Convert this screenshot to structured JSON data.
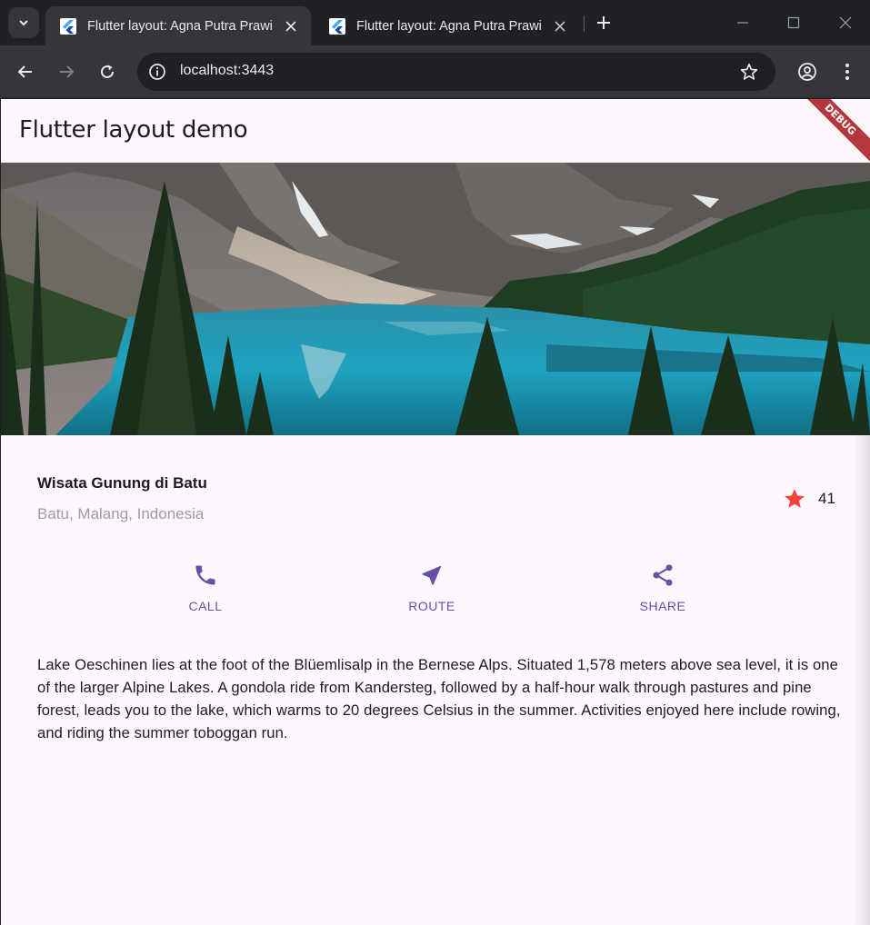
{
  "browser": {
    "tabs": [
      {
        "title": "Flutter layout: Agna Putra Prawi",
        "active": true
      },
      {
        "title": "Flutter layout: Agna Putra Prawi",
        "active": false
      }
    ],
    "url": "localhost:3443"
  },
  "app": {
    "title": "Flutter layout demo",
    "debug_banner": "DEBUG",
    "place": {
      "name": "Wisata Gunung di Batu",
      "location": "Batu, Malang, Indonesia",
      "star_count": "41"
    },
    "actions": [
      {
        "label": "CALL",
        "icon": "phone-icon"
      },
      {
        "label": "ROUTE",
        "icon": "near-me-icon"
      },
      {
        "label": "SHARE",
        "icon": "share-icon"
      }
    ],
    "description": "Lake Oeschinen lies at the foot of the Blüemlisalp in the Bernese Alps. Situated 1,578 meters above sea level, it is one of the larger Alpine Lakes. A gondola ride from Kandersteg, followed by a half-hour walk through pastures and pine forest, leads you to the lake, which warms to 20 degrees Celsius in the summer. Activities enjoyed here include rowing, and riding the summer toboggan run."
  },
  "colors": {
    "primary": "#6750a4",
    "star": "#f44336",
    "surface": "#fdf7fe",
    "debug_banner": "#b5373e"
  }
}
